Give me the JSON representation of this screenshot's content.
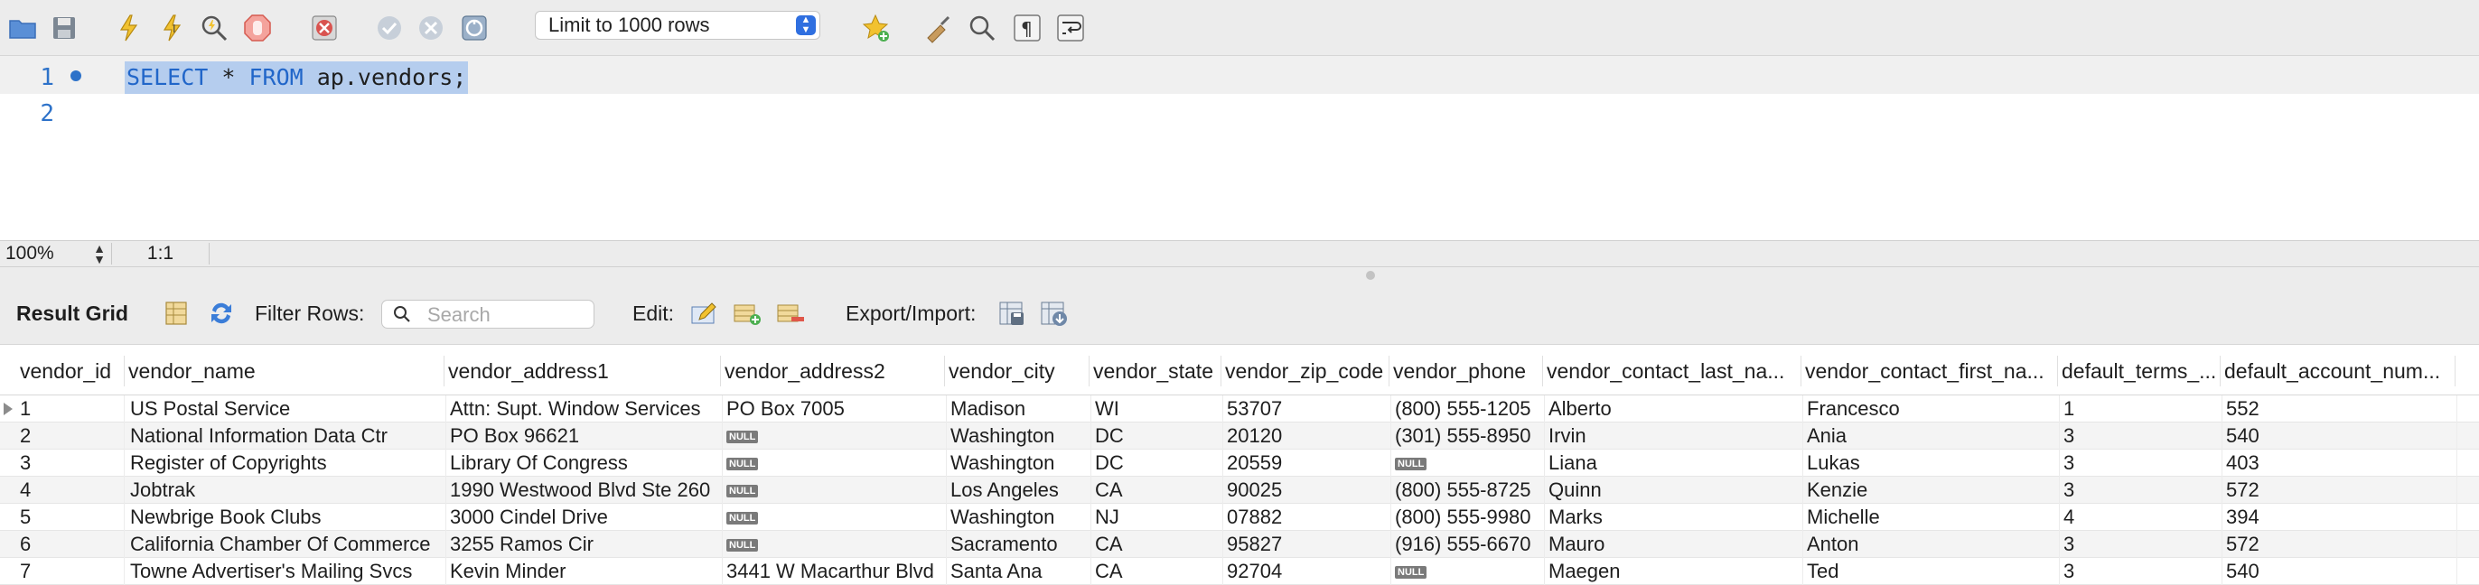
{
  "toolbar": {
    "limit_rows": "Limit to 1000 rows"
  },
  "editor": {
    "lines": [
      {
        "number": "1",
        "tokens": [
          {
            "text": "SELECT",
            "kind": "kw"
          },
          {
            "text": " * ",
            "kind": "plain"
          },
          {
            "text": "FROM",
            "kind": "kw"
          },
          {
            "text": " ap.vendors;",
            "kind": "plain"
          }
        ]
      },
      {
        "number": "2",
        "tokens": []
      }
    ]
  },
  "status": {
    "zoom": "100%",
    "position": "1:1"
  },
  "result_toolbar": {
    "title": "Result Grid",
    "filter_label": "Filter Rows:",
    "search_placeholder": "Search",
    "edit_label": "Edit:",
    "export_label": "Export/Import:"
  },
  "grid": {
    "columns": [
      "vendor_id",
      "vendor_name",
      "vendor_address1",
      "vendor_address2",
      "vendor_city",
      "vendor_state",
      "vendor_zip_code",
      "vendor_phone",
      "vendor_contact_last_na...",
      "vendor_contact_first_na...",
      "default_terms_...",
      "default_account_num..."
    ],
    "null_label": "NULL",
    "rows": [
      [
        "1",
        "US Postal Service",
        "Attn:  Supt. Window Services",
        "PO Box 7005",
        "Madison",
        "WI",
        "53707",
        "(800) 555-1205",
        "Alberto",
        "Francesco",
        "1",
        "552"
      ],
      [
        "2",
        "National Information Data Ctr",
        "PO Box 96621",
        null,
        "Washington",
        "DC",
        "20120",
        "(301) 555-8950",
        "Irvin",
        "Ania",
        "3",
        "540"
      ],
      [
        "3",
        "Register of Copyrights",
        "Library Of Congress",
        null,
        "Washington",
        "DC",
        "20559",
        null,
        "Liana",
        "Lukas",
        "3",
        "403"
      ],
      [
        "4",
        "Jobtrak",
        "1990 Westwood Blvd Ste 260",
        null,
        "Los Angeles",
        "CA",
        "90025",
        "(800) 555-8725",
        "Quinn",
        "Kenzie",
        "3",
        "572"
      ],
      [
        "5",
        "Newbrige Book Clubs",
        "3000 Cindel Drive",
        null,
        "Washington",
        "NJ",
        "07882",
        "(800) 555-9980",
        "Marks",
        "Michelle",
        "4",
        "394"
      ],
      [
        "6",
        "California Chamber Of Commerce",
        "3255 Ramos Cir",
        null,
        "Sacramento",
        "CA",
        "95827",
        "(916) 555-6670",
        "Mauro",
        "Anton",
        "3",
        "572"
      ],
      [
        "7",
        "Towne Advertiser's Mailing Svcs",
        "Kevin Minder",
        "3441 W Macarthur Blvd",
        "Santa Ana",
        "CA",
        "92704",
        null,
        "Maegen",
        "Ted",
        "3",
        "540"
      ]
    ]
  }
}
